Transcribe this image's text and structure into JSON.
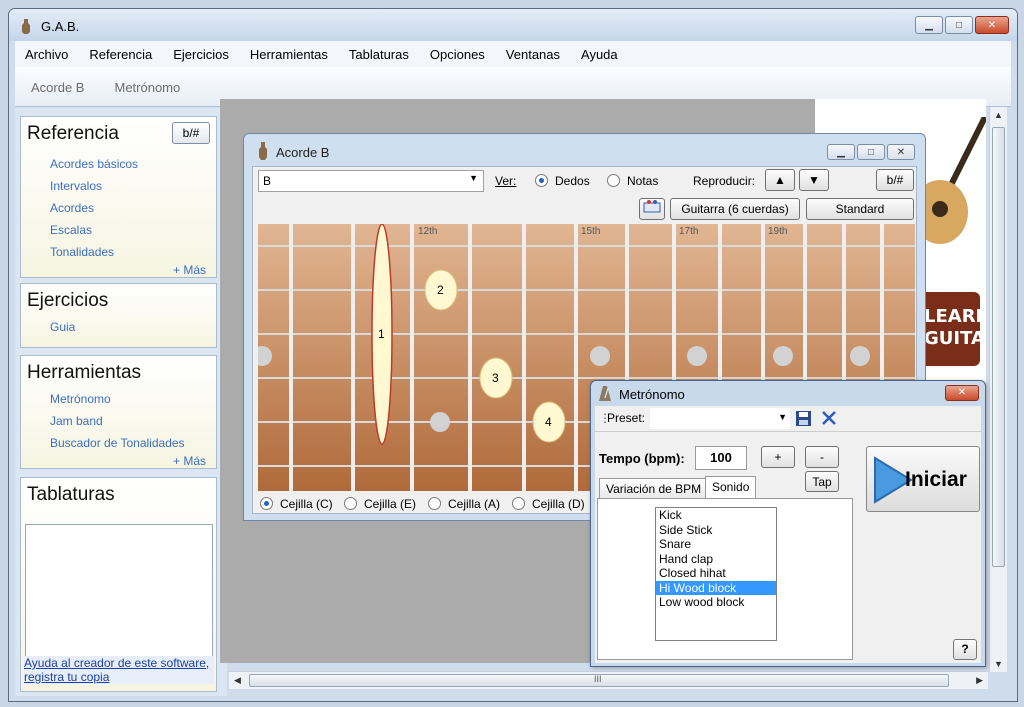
{
  "window": {
    "title": "G.A.B.",
    "minimize": "▁",
    "maximize": "□",
    "close": "✕"
  },
  "menu": {
    "items": [
      "Archivo",
      "Referencia",
      "Ejercicios",
      "Herramientas",
      "Tablaturas",
      "Opciones",
      "Ventanas",
      "Ayuda"
    ]
  },
  "toolbar": {
    "items": [
      "Acorde B",
      "Metrónomo"
    ]
  },
  "sidebar": {
    "referencia": {
      "title": "Referencia",
      "bflat": "b/#",
      "links": [
        "Acordes básicos",
        "Intervalos",
        "Acordes",
        "Escalas",
        "Tonalidades"
      ],
      "more": "+ Más"
    },
    "ejercicios": {
      "title": "Ejercicios",
      "links": [
        "Guia"
      ]
    },
    "herramientas": {
      "title": "Herramientas",
      "links": [
        "Metrónomo",
        "Jam band",
        "Buscador de Tonalidades"
      ],
      "more": "+ Más"
    },
    "tablaturas": {
      "title": "Tablaturas"
    },
    "help_link_1": "Ayuda al creador de este software,",
    "help_link_2": "registra tu copia"
  },
  "chord_window": {
    "title": "Acorde B",
    "note": "B",
    "ver_label": "Ver:",
    "view_options": [
      {
        "label": "Dedos",
        "selected": true
      },
      {
        "label": "Notas",
        "selected": false
      }
    ],
    "reproducir_label": "Reproducir:",
    "bflat": "b/#",
    "instrument": "Guitarra (6 cuerdas)",
    "tuning": "Standard",
    "fret_labels": [
      "12th",
      "15th",
      "17th",
      "19th"
    ],
    "finger_marks": [
      "1",
      "2",
      "3",
      "4"
    ],
    "barre_options": [
      {
        "label": "Cejilla (C)",
        "selected": true
      },
      {
        "label": "Cejilla (E)",
        "selected": false
      },
      {
        "label": "Cejilla (A)",
        "selected": false
      },
      {
        "label": "Cejilla (D)",
        "selected": false
      }
    ]
  },
  "metronome": {
    "title": "Metrónomo",
    "preset_label": "Preset:",
    "preset_value": "",
    "tempo_label": "Tempo (bpm):",
    "tempo_value": "100",
    "plus": "+",
    "minus": "-",
    "tap": "Tap",
    "start": "Iniciar",
    "tabs": [
      "Variación de BPM",
      "Sonido"
    ],
    "active_tab": "Sonido",
    "sounds": [
      "Kick",
      "Side Stick",
      "Snare",
      "Hand clap",
      "Closed hihat",
      "Hi Wood block",
      "Low wood block"
    ],
    "selected_sound": "Hi Wood block",
    "help": "?"
  },
  "ad": {
    "text_line1": "LEARN",
    "text_line2": "GUITA"
  },
  "scroll": {
    "h_grip": "III"
  },
  "colors": {
    "link": "#3c6ec0",
    "selection": "#3399ff",
    "fretboard": "#c78a5e",
    "finger_mark": "#fff8d0"
  }
}
